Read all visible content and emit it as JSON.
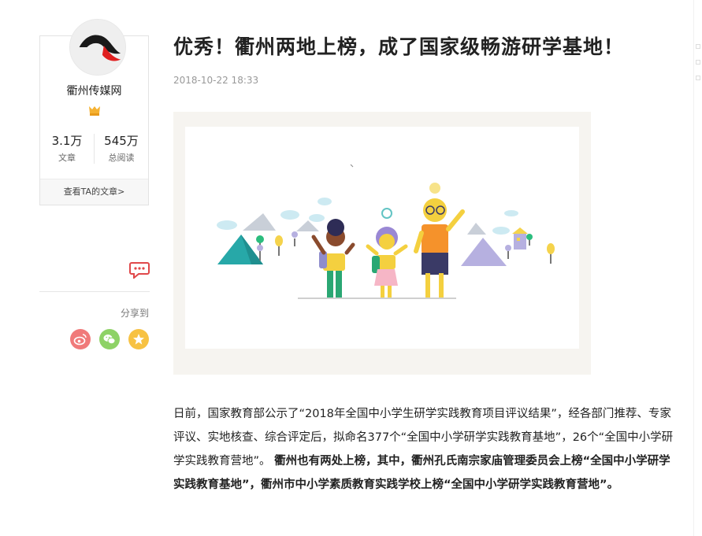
{
  "author": {
    "name": "衢州传媒网",
    "stats": [
      {
        "value": "3.1万",
        "label": "文章"
      },
      {
        "value": "545万",
        "label": "总阅读"
      }
    ],
    "view_articles_link": "查看TA的文章>"
  },
  "share": {
    "label": "分享到",
    "buttons": [
      "weibo-icon",
      "wechat-icon",
      "favorite-icon"
    ]
  },
  "article": {
    "title": "优秀！衢州两地上榜，成了国家级畅游研学基地！",
    "date": "2018-10-22 18:33",
    "paragraph": {
      "normal": "日前，国家教育部公示了“2018年全国中小学生研学实践教育项目评议结果”，经各部门推荐、专家评议、实地核查、综合评定后，拟命名377个“全国中小学研学实践教育基地”，26个“全国中小学研学实践教育营地”。",
      "bold": "衢州也有两处上榜，其中，衢州孔氏南宗家庙管理委员会上榜“全国中小学研学实践教育基地”，衢州市中小学素质教育实践学校上榜“全国中小学研学实践教育营地”。"
    }
  },
  "colors": {
    "weibo": "#f07a7a",
    "wechat": "#8ed266",
    "favorite": "#f7c243",
    "comment": "#e0484a"
  }
}
